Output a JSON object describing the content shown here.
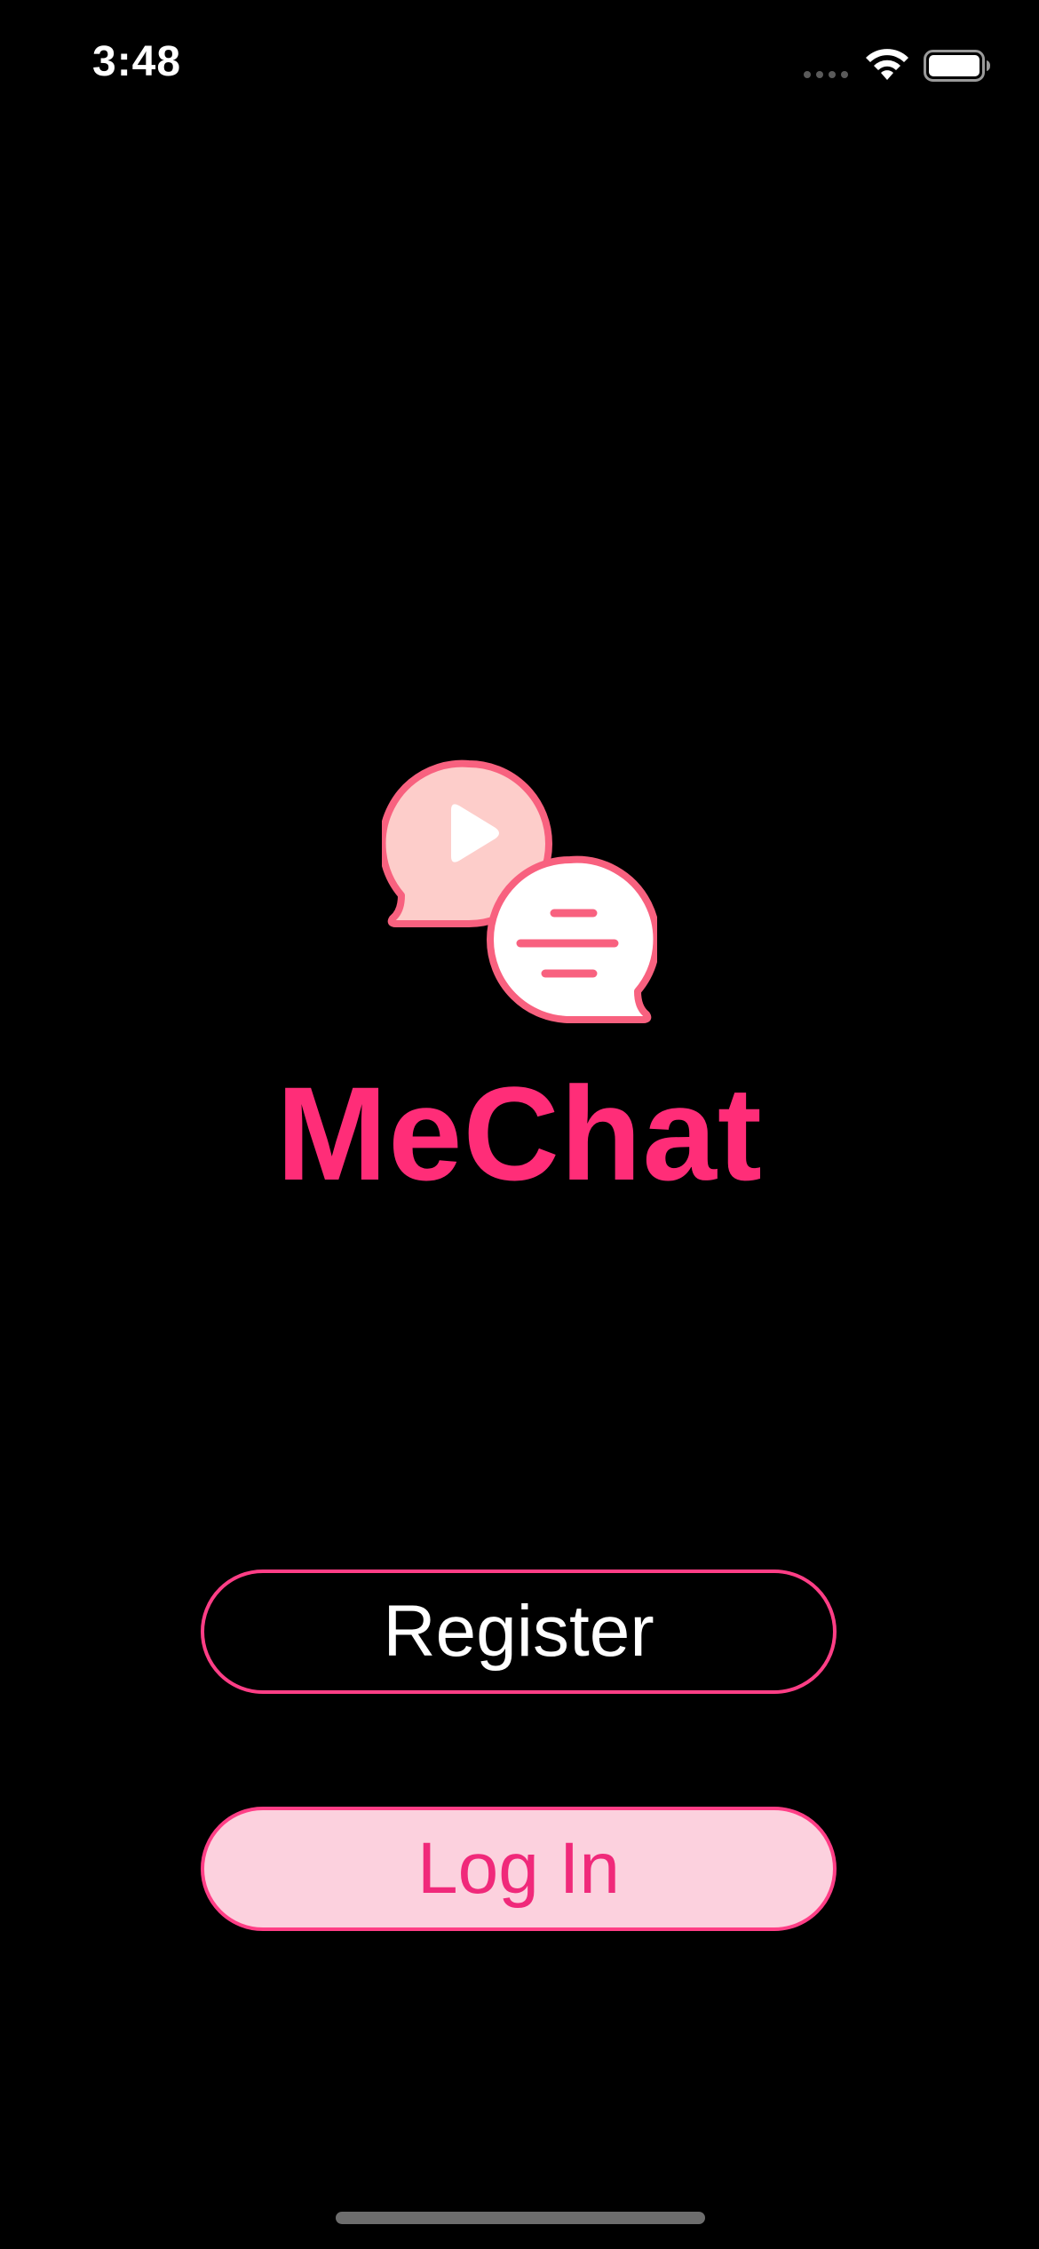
{
  "status_bar": {
    "time": "3:48",
    "icons": [
      "cellular-signal-icon",
      "wifi-icon",
      "battery-icon"
    ]
  },
  "app": {
    "logo_icon": "chat-bubbles-logo-icon",
    "title": "MeChat",
    "title_color": "#ff2d78"
  },
  "actions": {
    "register_label": "Register",
    "login_label": "Log In"
  },
  "colors": {
    "background": "#000000",
    "accent": "#ff3e86",
    "login_fill": "#fcd1de",
    "logo_bubble_fill": "#fdcdca",
    "logo_stroke": "#f8617f"
  }
}
